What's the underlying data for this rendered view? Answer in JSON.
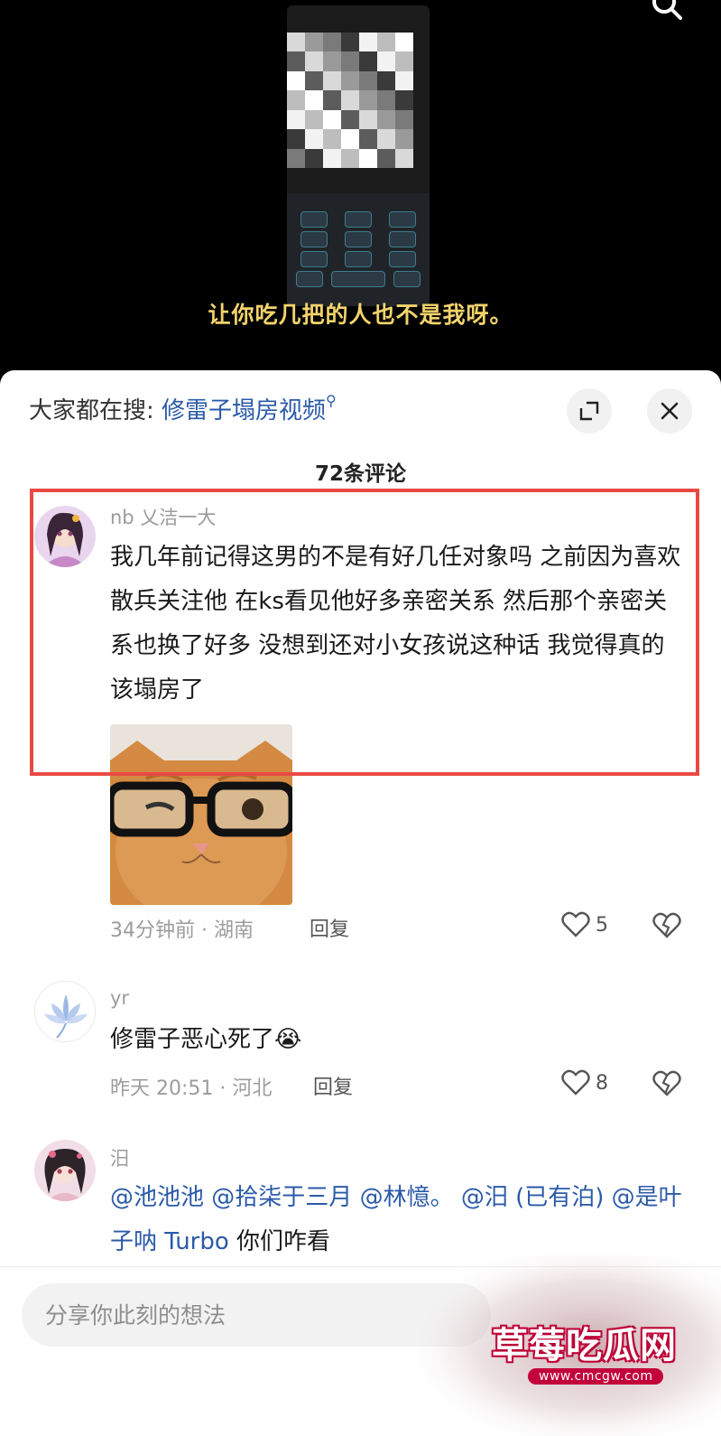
{
  "video": {
    "subtitle": "让你吃几把的人也不是我呀。",
    "icons": {
      "top_right": "search-icon"
    }
  },
  "sheet": {
    "suggest_prefix": "大家都在搜:",
    "suggest_query": "修雷子塌房视频",
    "comment_count": "72条评论",
    "icons": {
      "expand": "expand-icon",
      "close": "close-icon"
    }
  },
  "comments": [
    {
      "user": "nb 乂洁一大",
      "text": "我几年前记得这男的不是有好几任对象吗 之前因为喜欢散兵关注他 在ks看见他好多亲密关系 然后那个亲密关系也换了好多 没想到还对小女孩说这种话 我觉得真的该塌房了",
      "meta": "34分钟前 · 湖南",
      "reply": "回复",
      "likes": "5"
    },
    {
      "user": "yr",
      "text": "修雷子恶心死了",
      "emoji": "😭",
      "meta": "昨天 20:51 · 河北",
      "reply": "回复",
      "likes": "8"
    },
    {
      "user": "汨",
      "mentions": [
        "@池池池",
        "@拾柒于三月",
        "@林憶。",
        "@汨 (已有泊)",
        "@是叶子呐 Turbo"
      ],
      "tail": "你们咋看"
    }
  ],
  "input": {
    "placeholder": "分享你此刻的想法"
  },
  "watermark": {
    "title": "草莓吃瓜网",
    "url": "www.cmcgw.com"
  },
  "colors": {
    "accent_blue": "#2b5aa8",
    "highlight_red": "#e84a43",
    "subtitle_yellow": "#f3d36b"
  }
}
